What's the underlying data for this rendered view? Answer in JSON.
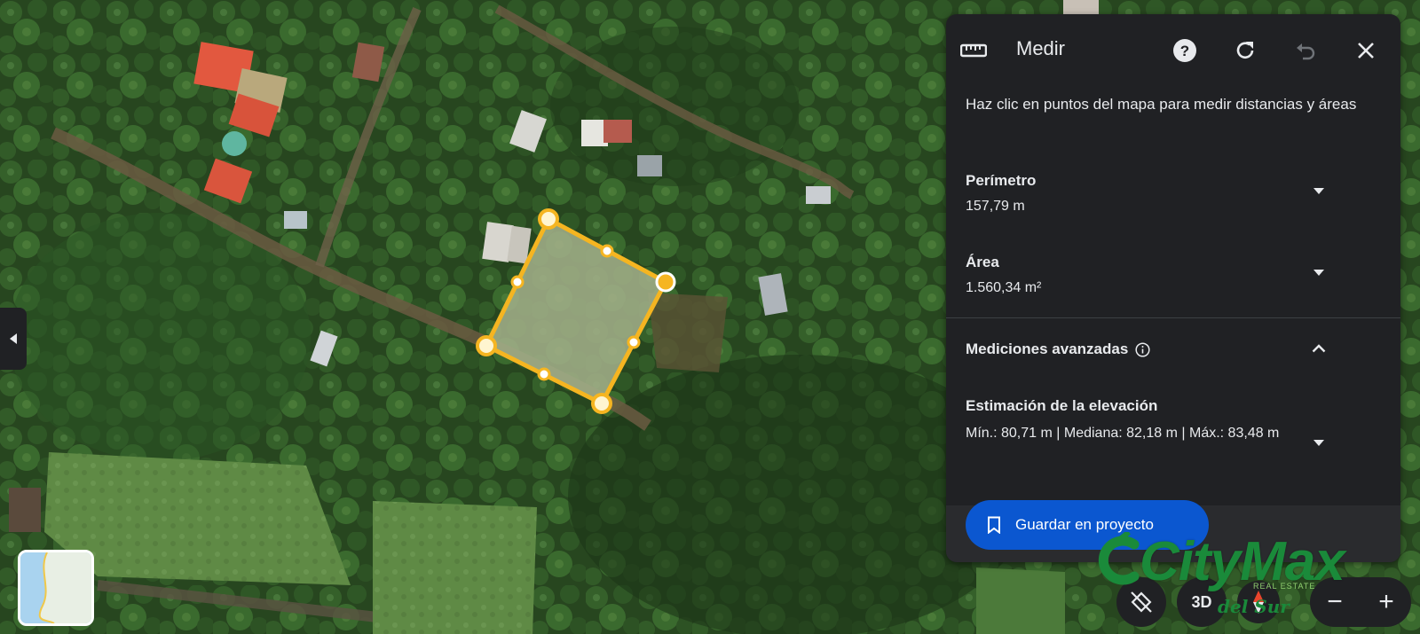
{
  "colors": {
    "panel_bg": "#202124",
    "accent_button": "#0b57d0",
    "polygon_stroke": "#f5b521",
    "text": "#e8eaed",
    "watermark": "#1a8a3a"
  },
  "panel": {
    "title": "Medir",
    "title_icon": "ruler-icon",
    "header_icons": [
      "help-icon",
      "reset-icon",
      "undo-icon",
      "close-icon"
    ],
    "description": "Haz clic en puntos del mapa para medir distancias y áreas",
    "perimeter": {
      "label": "Perímetro",
      "value": "157,79 m"
    },
    "area": {
      "label": "Área",
      "value": "1.560,34 m²"
    },
    "advanced": {
      "label": "Mediciones avanzadas",
      "info_icon": "info-icon"
    },
    "elevation": {
      "label": "Estimación de la elevación",
      "value": "Mín.: 80,71 m | Mediana: 82,18 m | Máx.: 83,48 m"
    },
    "save_button": {
      "label": "Guardar en proyecto",
      "icon": "bookmark-icon"
    }
  },
  "map_controls": {
    "three_d_label": "3D",
    "zoom_out": "−",
    "zoom_in": "+"
  },
  "watermark": {
    "brand": "CityMax",
    "sub": "del Sur",
    "tag": "REAL ESTATE"
  }
}
